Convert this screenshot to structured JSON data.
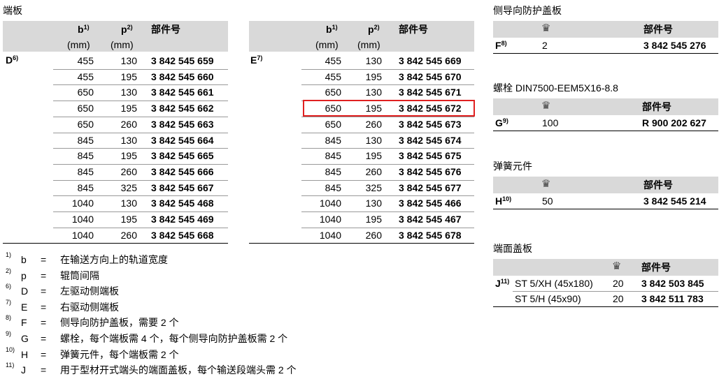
{
  "end_plate": {
    "title": "端板",
    "col_b": "b",
    "col_b_sup": "1)",
    "col_p": "p",
    "col_p_sup": "2)",
    "col_part": "部件号",
    "unit": "(mm)",
    "left": {
      "label": "D",
      "label_sup": "6)",
      "rows": [
        {
          "b": "455",
          "p": "130",
          "part": "3 842 545 659"
        },
        {
          "b": "455",
          "p": "195",
          "part": "3 842 545 660"
        },
        {
          "b": "650",
          "p": "130",
          "part": "3 842 545 661"
        },
        {
          "b": "650",
          "p": "195",
          "part": "3 842 545 662"
        },
        {
          "b": "650",
          "p": "260",
          "part": "3 842 545 663"
        },
        {
          "b": "845",
          "p": "130",
          "part": "3 842 545 664"
        },
        {
          "b": "845",
          "p": "195",
          "part": "3 842 545 665"
        },
        {
          "b": "845",
          "p": "260",
          "part": "3 842 545 666"
        },
        {
          "b": "845",
          "p": "325",
          "part": "3 842 545 667"
        },
        {
          "b": "1040",
          "p": "130",
          "part": "3 842 545 468"
        },
        {
          "b": "1040",
          "p": "195",
          "part": "3 842 545 469"
        },
        {
          "b": "1040",
          "p": "260",
          "part": "3 842 545 668"
        }
      ]
    },
    "right": {
      "label": "E",
      "label_sup": "7)",
      "rows": [
        {
          "b": "455",
          "p": "130",
          "part": "3 842 545 669"
        },
        {
          "b": "455",
          "p": "195",
          "part": "3 842 545 670"
        },
        {
          "b": "650",
          "p": "130",
          "part": "3 842 545 671"
        },
        {
          "b": "650",
          "p": "195",
          "part": "3 842 545 672"
        },
        {
          "b": "650",
          "p": "260",
          "part": "3 842 545 673"
        },
        {
          "b": "845",
          "p": "130",
          "part": "3 842 545 674"
        },
        {
          "b": "845",
          "p": "195",
          "part": "3 842 545 675"
        },
        {
          "b": "845",
          "p": "260",
          "part": "3 842 545 676"
        },
        {
          "b": "845",
          "p": "325",
          "part": "3 842 545 677"
        },
        {
          "b": "1040",
          "p": "130",
          "part": "3 842 545 466"
        },
        {
          "b": "1040",
          "p": "195",
          "part": "3 842 545 467"
        },
        {
          "b": "1040",
          "p": "260",
          "part": "3 842 545 678"
        }
      ]
    }
  },
  "side_guard": {
    "title": "侧导向防护盖板",
    "col_part": "部件号",
    "label": "F",
    "label_sup": "8)",
    "qty": "2",
    "part": "3 842 545 276"
  },
  "bolt": {
    "title": "螺栓 DIN7500-EEM5X16-8.8",
    "col_part": "部件号",
    "label": "G",
    "label_sup": "9)",
    "qty": "100",
    "part": "R 900 202 627"
  },
  "spring": {
    "title": "弹簧元件",
    "col_part": "部件号",
    "label": "H",
    "label_sup": "10)",
    "qty": "50",
    "part": "3 842 545 214"
  },
  "end_cap": {
    "title": "端面盖板",
    "col_part": "部件号",
    "label": "J",
    "label_sup": "11)",
    "rows": [
      {
        "name": "ST 5/XH (45x180)",
        "qty": "20",
        "part": "3 842 503 845"
      },
      {
        "name": "ST 5/H (45x90)",
        "qty": "20",
        "part": "3 842 511 783"
      }
    ]
  },
  "footnotes": [
    {
      "sup": "1)",
      "key": "b",
      "eq": "=",
      "text": "在输送方向上的轨道宽度"
    },
    {
      "sup": "2)",
      "key": "p",
      "eq": "=",
      "text": "辊筒间隔"
    },
    {
      "sup": "6)",
      "key": "D",
      "eq": "=",
      "text": "左驱动侧端板"
    },
    {
      "sup": "7)",
      "key": "E",
      "eq": "=",
      "text": "右驱动侧端板"
    },
    {
      "sup": "8)",
      "key": "F",
      "eq": "=",
      "text": "侧导向防护盖板，需要 2 个"
    },
    {
      "sup": "9)",
      "key": "G",
      "eq": "=",
      "text": "螺栓，每个端板需 4 个，每个侧导向防护盖板需 2 个"
    },
    {
      "sup": "10)",
      "key": "H",
      "eq": "=",
      "text": "弹簧元件，每个端板需 2 个"
    },
    {
      "sup": "11)",
      "key": "J",
      "eq": "=",
      "text": "用于型材开式端头的端面盖板，每个输送段端头需 2 个"
    }
  ],
  "qty_icon": "packaging-unit-icon"
}
